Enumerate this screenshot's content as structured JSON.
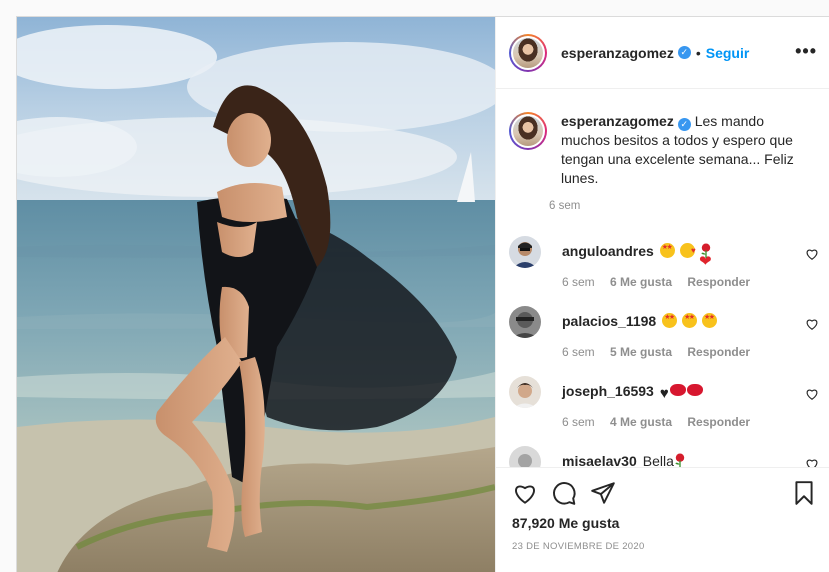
{
  "post": {
    "username": "esperanzagomez",
    "follow_label": "Seguir",
    "separator": "•",
    "more_label": "•••",
    "caption": "Les mando muchos besitos a todos y espero que tengan una excelente semana... Feliz lunes.",
    "caption_time": "6 sem",
    "likes": "87,920 Me gusta",
    "date": "23 DE NOVIEMBRE DE 2020"
  },
  "comments": [
    {
      "username": "anguloandres",
      "text": "",
      "emojis": [
        "star-struck",
        "face-blowing-kiss",
        "red-heart",
        "rose"
      ],
      "time": "6 sem",
      "likes": "6 Me gusta",
      "reply": "Responder"
    },
    {
      "username": "palacios_1198",
      "text": "",
      "emojis": [
        "star-struck",
        "star-struck",
        "star-struck"
      ],
      "time": "6 sem",
      "likes": "5 Me gusta",
      "reply": "Responder"
    },
    {
      "username": "joseph_16593",
      "text": "",
      "emojis": [
        "black-heart",
        "kiss-mark",
        "kiss-mark"
      ],
      "time": "6 sem",
      "likes": "4 Me gusta",
      "reply": "Responder"
    },
    {
      "username": "misaelav30",
      "text": "Bella",
      "emojis": [
        "rose"
      ]
    }
  ],
  "icons": [
    "like-icon",
    "comment-icon",
    "share-icon",
    "save-icon",
    "verified-badge-icon",
    "comment-like-icon"
  ],
  "colors": {
    "link": "#0095f6",
    "verified": "#3897f0",
    "muted": "#8e8e8e",
    "text": "#262626",
    "border": "#dbdbdb"
  }
}
